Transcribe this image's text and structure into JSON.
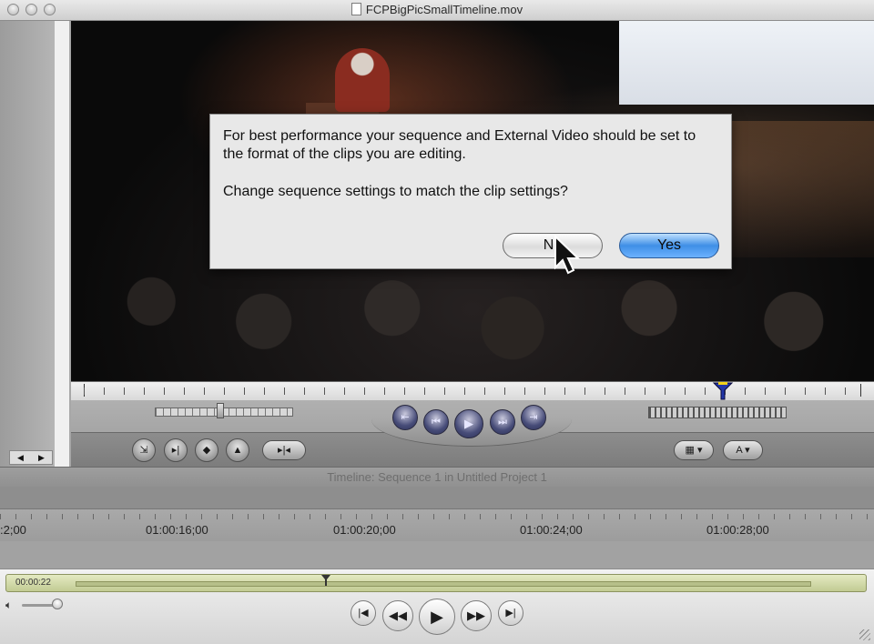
{
  "window": {
    "title": "FCPBigPicSmallTimeline.mov"
  },
  "dialog": {
    "message_line1": "For best performance your sequence and External Video should be set to the format of the clips you are editing.",
    "message_line2": "Change sequence settings to match the clip settings?",
    "no_label": "No",
    "yes_label": "Yes"
  },
  "timeline": {
    "title": "Timeline: Sequence 1 in Untitled Project 1",
    "ruler_labels": [
      ":2;00",
      "01:00:16;00",
      "01:00:20;00",
      "01:00:24;00",
      "01:00:28;00"
    ]
  },
  "player": {
    "timecode": "00:00:22",
    "progress": 0.34
  },
  "icons": {
    "volume": "speaker-icon",
    "rewind": "rewind-icon",
    "play": "play-icon",
    "forward": "fast-forward-icon",
    "skip_back": "skip-back-icon",
    "skip_forward": "skip-forward-icon"
  },
  "colors": {
    "yes_button": "#3f8fe6",
    "transport_button": "#474c78",
    "scrubber": "#c2cb93"
  }
}
